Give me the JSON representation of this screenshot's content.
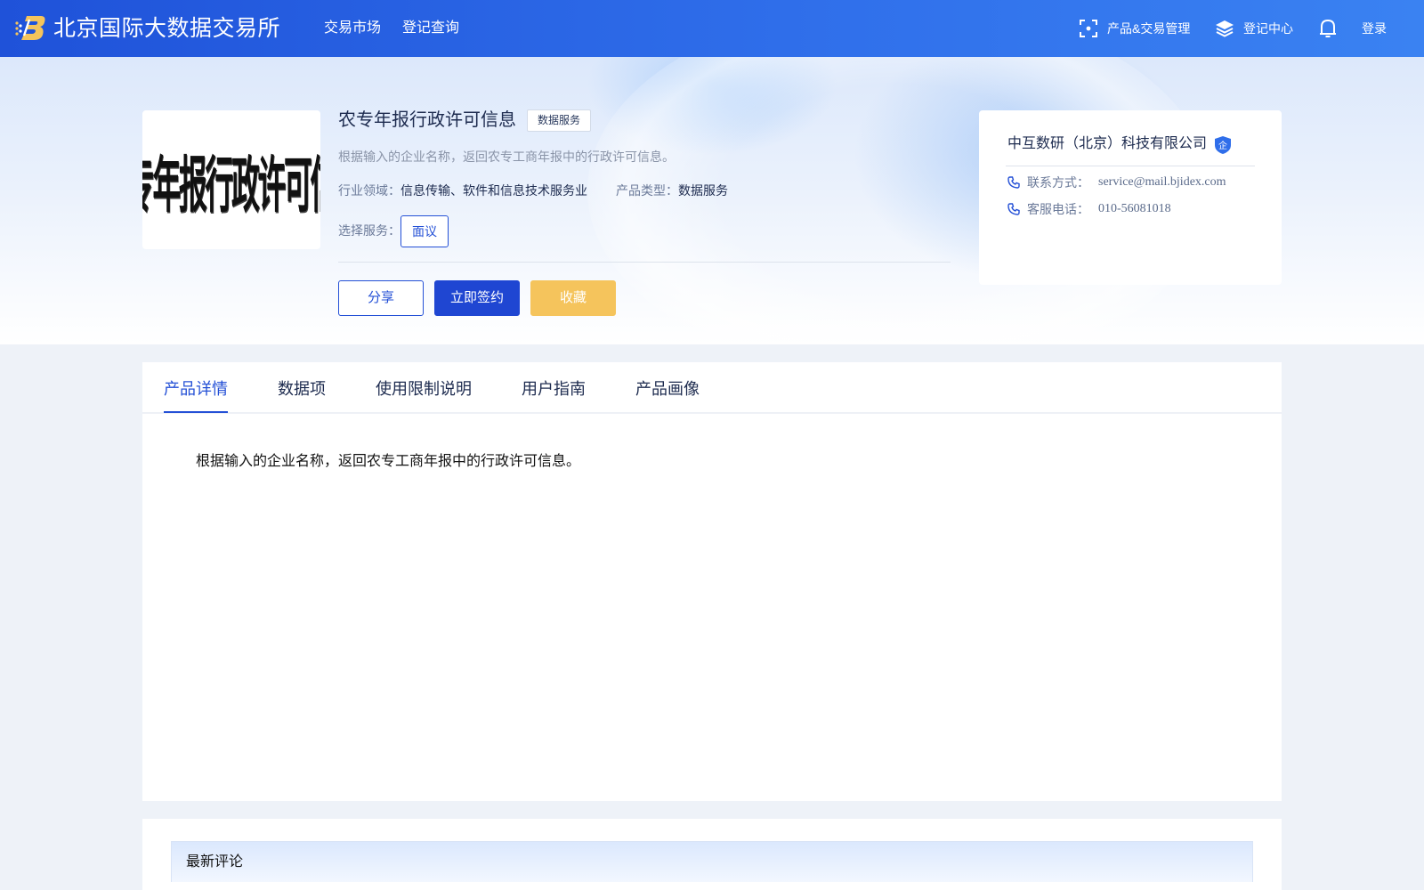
{
  "header": {
    "site_title": "北京国际大数据交易所",
    "nav": [
      "交易市场",
      "登记查询"
    ],
    "product_trade_mgmt": "产品&交易管理",
    "registration_center": "登记中心",
    "login": "登录"
  },
  "product": {
    "thumbnail_text": "农专年报行政许可信息",
    "name": "农专年报行政许可信息",
    "type_tag": "数据服务",
    "description": "根据输入的企业名称，返回农专工商年报中的行政许可信息。",
    "industry_label": "行业领域：",
    "industry_value": "信息传输、软件和信息技术服务业",
    "type_label": "产品类型：",
    "type_value": "数据服务",
    "service_label": "选择服务：",
    "service_option": "面议",
    "buttons": {
      "share": "分享",
      "sign": "立即签约",
      "favorite": "收藏"
    }
  },
  "vendor": {
    "name": "中互数研（北京）科技有限公司",
    "badge": "企",
    "contact_label": "联系方式：",
    "contact_value": "service@mail.bjidex.com",
    "phone_label": "客服电话：",
    "phone_value": "010-56081018"
  },
  "tabs": [
    {
      "label": "产品详情",
      "active": true
    },
    {
      "label": "数据项",
      "active": false
    },
    {
      "label": "使用限制说明",
      "active": false
    },
    {
      "label": "用户指南",
      "active": false
    },
    {
      "label": "产品画像",
      "active": false
    }
  ],
  "detail": {
    "text": "根据输入的企业名称，返回农专工商年报中的行政许可信息。"
  },
  "comments": {
    "title": "最新评论"
  },
  "colors": {
    "header_start": "#1f52d9",
    "header_end": "#3a82f2",
    "primary": "#2450d6",
    "favorite": "#f5c45c"
  }
}
